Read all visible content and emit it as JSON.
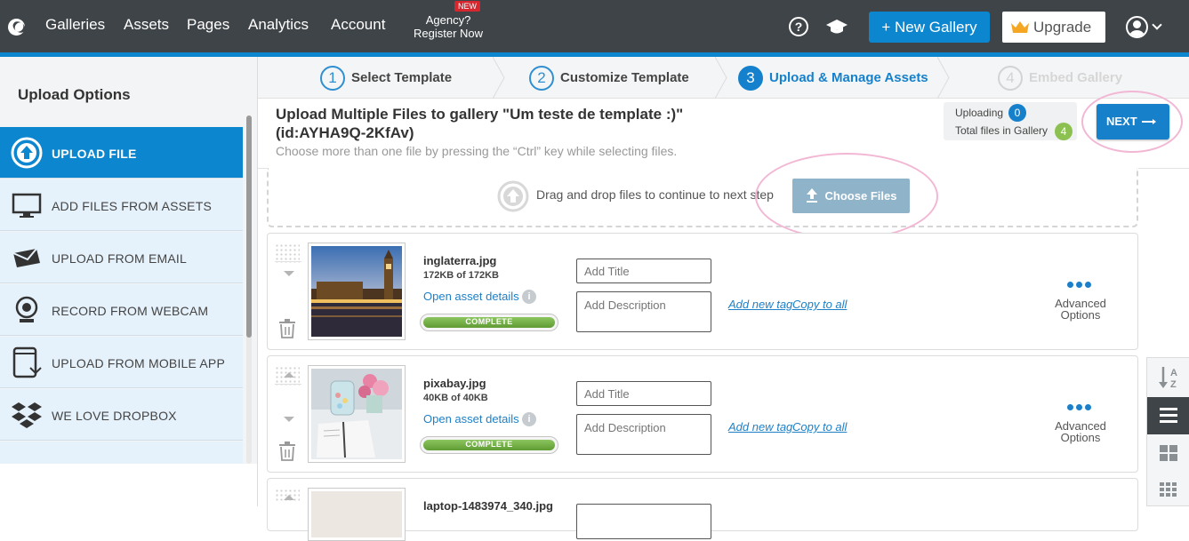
{
  "nav": {
    "items": [
      "Galleries",
      "Assets",
      "Pages",
      "Analytics",
      "Account"
    ],
    "agency_line1": "Agency?",
    "agency_line2": "Register Now",
    "new_badge": "NEW",
    "new_gallery": "+ New Gallery",
    "upgrade": "Upgrade"
  },
  "sidebar": {
    "title": "Upload Options",
    "items": [
      {
        "label": "UPLOAD FILE",
        "icon": "upload-circle-icon"
      },
      {
        "label": "ADD FILES FROM ASSETS",
        "icon": "monitor-icon"
      },
      {
        "label": "UPLOAD FROM EMAIL",
        "icon": "envelope-icon"
      },
      {
        "label": "RECORD FROM WEBCAM",
        "icon": "webcam-icon"
      },
      {
        "label": "UPLOAD FROM MOBILE APP",
        "icon": "mobile-icon"
      },
      {
        "label": "WE LOVE DROPBOX",
        "icon": "dropbox-icon"
      }
    ]
  },
  "steps": [
    {
      "number": "1",
      "label": "Select Template"
    },
    {
      "number": "2",
      "label": "Customize Template"
    },
    {
      "number": "3",
      "label": "Upload & Manage Assets"
    },
    {
      "number": "4",
      "label": "Embed Gallery"
    }
  ],
  "header": {
    "title_line1": "Upload Multiple Files to gallery \"Um teste de template :)\"",
    "title_line2": "(id:AYHA9Q-2KfAv)",
    "hint": "Choose more than one file by pressing the “Ctrl” key while selecting files.",
    "uploading_label": "Uploading",
    "uploading_count": "0",
    "total_label": "Total files in Gallery",
    "total_count": "4",
    "next": "NEXT"
  },
  "dropzone": {
    "text": "Drag and drop files to continue to next step",
    "choose": "Choose Files"
  },
  "assets": [
    {
      "name": "inglaterra.jpg",
      "size": "172KB of 172KB",
      "details": "Open asset details",
      "status": "COMPLETE",
      "progress": 1.0,
      "title_placeholder": "Add Title",
      "desc_placeholder": "Add Description",
      "tag": "Add new tag",
      "copy": "Copy to all",
      "advanced": "Advanced Options"
    },
    {
      "name": "pixabay.jpg",
      "size": "40KB of 40KB",
      "details": "Open asset details",
      "status": "COMPLETE",
      "progress": 1.0,
      "title_placeholder": "Add Title",
      "desc_placeholder": "Add Description",
      "tag": "Add new tag",
      "copy": "Copy to all",
      "advanced": "Advanced Options"
    },
    {
      "name": "laptop-1483974_340.jpg"
    }
  ],
  "colors": {
    "topbar": "#3f4448",
    "accent": "#0d86d0",
    "progress": "#6aaa3a",
    "badge_total": "#8cc152"
  }
}
